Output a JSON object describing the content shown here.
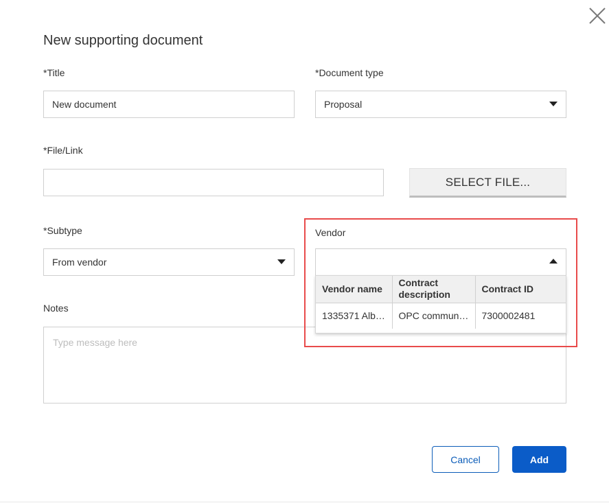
{
  "dialog": {
    "title": "New supporting document",
    "close_icon": "close-icon"
  },
  "form": {
    "title_label": "*Title",
    "title_value": "New document",
    "doc_type_label": "*Document type",
    "doc_type_value": "Proposal",
    "file_label": "*File/Link",
    "file_value": "",
    "select_file_label": "SELECT FILE...",
    "subtype_label": "*Subtype",
    "subtype_value": "From vendor",
    "vendor_label": "Vendor",
    "vendor_value": "",
    "notes_label": "Notes",
    "notes_placeholder": "Type message here"
  },
  "vendor_dropdown": {
    "columns": [
      "Vendor name",
      "Contract description",
      "Contract ID"
    ],
    "rows": [
      {
        "vendor_name": "1335371 Albe...",
        "contract_description": "OPC communi...",
        "contract_id": "7300002481"
      }
    ]
  },
  "actions": {
    "cancel_label": "Cancel",
    "add_label": "Add"
  },
  "colors": {
    "primary": "#0b5cc8",
    "highlight": "#e84a4a",
    "border": "#cfcfcf"
  }
}
